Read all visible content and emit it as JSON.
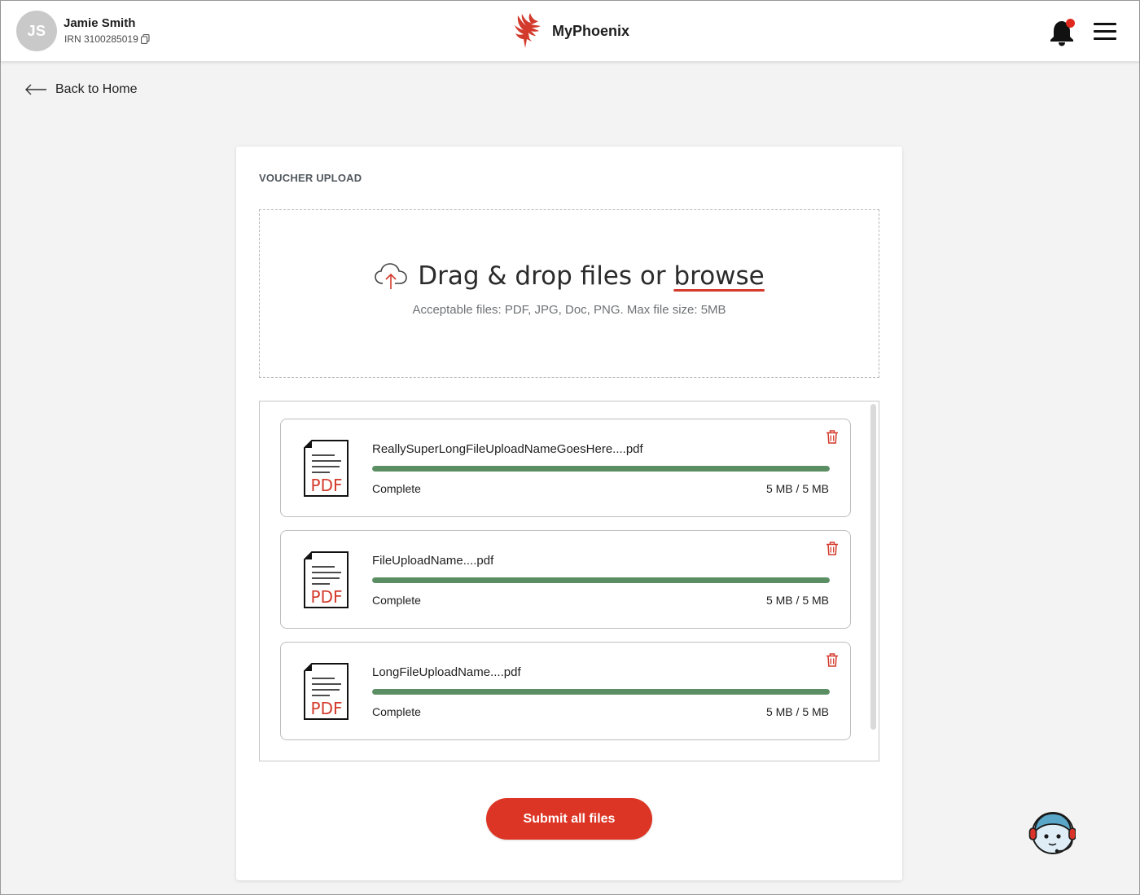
{
  "header": {
    "avatar_initials": "JS",
    "user_name": "Jamie Smith",
    "irn": "IRN 3100285019",
    "brand_name": "MyPhoenix",
    "brand_color": "#d33a2c",
    "notification_dot_color": "#e0281d"
  },
  "nav": {
    "back_label": "Back to Home"
  },
  "card": {
    "title": "VOUCHER UPLOAD",
    "dropzone": {
      "text": "Drag & drop files or",
      "browse_label": "browse",
      "hint": "Acceptable files: PDF, JPG, Doc, PNG. Max file size: 5MB"
    },
    "files": [
      {
        "name": "ReallySuperLongFileUploadNameGoesHere....pdf",
        "status": "Complete",
        "size": "5 MB / 5 MB",
        "progress": 1.0,
        "icon_label": "PDF"
      },
      {
        "name": "FileUploadName....pdf",
        "status": "Complete",
        "size": "5 MB / 5 MB",
        "progress": 1.0,
        "icon_label": "PDF"
      },
      {
        "name": "LongFileUploadName....pdf",
        "status": "Complete",
        "size": "5 MB / 5 MB",
        "progress": 1.0,
        "icon_label": "PDF"
      }
    ],
    "submit_label": "Submit all files"
  },
  "colors": {
    "accent": "#dc3525",
    "progress": "#5c8e63"
  },
  "icons": [
    "copy-icon",
    "phoenix-logo-icon",
    "bell-icon",
    "hamburger-menu-icon",
    "arrow-left-icon",
    "cloud-upload-icon",
    "pdf-file-icon",
    "trash-icon",
    "chat-assistant-icon"
  ]
}
